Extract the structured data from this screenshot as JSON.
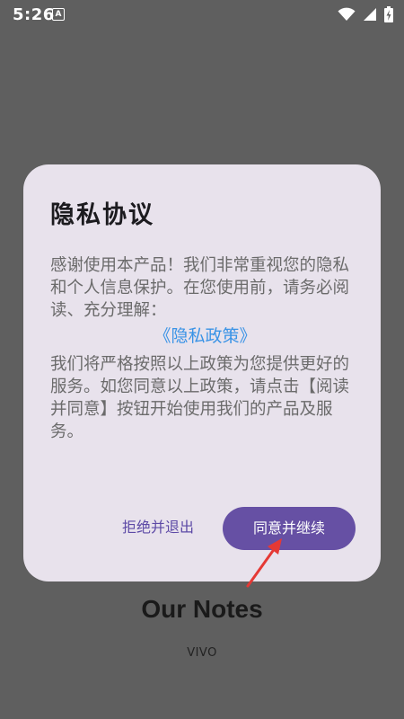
{
  "status_bar": {
    "time": "5:26",
    "notification_badge": "A",
    "icons": [
      "wifi-icon",
      "signal-icon",
      "battery-charging-icon"
    ]
  },
  "app": {
    "title": "Our Notes",
    "brand": "VIVO"
  },
  "dialog": {
    "title": "隐私协议",
    "paragraph1": "感谢使用本产品！我们非常重视您的隐私和个人信息保护。在您使用前，请务必阅读、充分理解：",
    "policy_link": "《隐私政策》",
    "paragraph2": "我们将严格按照以上政策为您提供更好的服务。如您同意以上政策，请点击【阅读并同意】按钮开始使用我们的产品及服务。",
    "reject_label": "拒绝并退出",
    "accept_label": "同意并继续"
  },
  "colors": {
    "scrim": "#5f5f5f",
    "dialog_bg": "#e8e2ec",
    "accent": "#6650a4",
    "link": "#3a93e6",
    "annotation": "#e53935"
  }
}
